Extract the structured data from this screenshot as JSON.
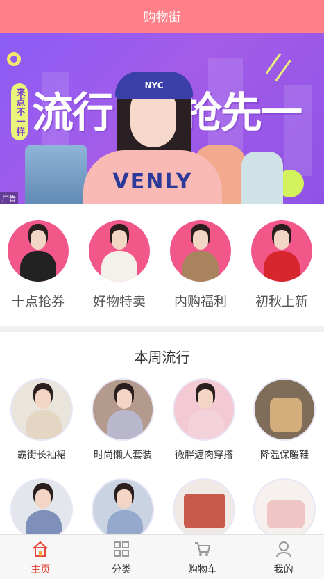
{
  "header": {
    "title": "购物街"
  },
  "banner": {
    "badge": "来点不一样",
    "slogan_left": "流行",
    "slogan_right": "抢先一步",
    "hat_text": "NYC",
    "shirt_text": "VENLY",
    "ad_label": "广告"
  },
  "categories": [
    {
      "label": "十点抢券",
      "shirt_color": "#222222"
    },
    {
      "label": "好物特卖",
      "shirt_color": "#f4f0ea"
    },
    {
      "label": "内购福利",
      "shirt_color": "#a8835e"
    },
    {
      "label": "初秋上新",
      "shirt_color": "#d8262e"
    }
  ],
  "weekly": {
    "title": "本周流行",
    "items": [
      {
        "label": "霸街长袖裙",
        "bg": "#e9e4dc",
        "shirt": "#e5d6c4"
      },
      {
        "label": "时尚懒人套装",
        "bg": "#b39a8c",
        "shirt": "#b9b7cc"
      },
      {
        "label": "微胖遮肉穿搭",
        "bg": "#f3c9d4",
        "shirt": "#f4d2dc"
      },
      {
        "label": "降温保暖鞋",
        "bg": "#7f6d5a",
        "shirt": "#d4ad7c"
      },
      {
        "label": "",
        "bg": "#e4e6ee",
        "shirt": "#7e8fb9"
      },
      {
        "label": "",
        "bg": "#c9d3e2",
        "shirt": "#95a9cc"
      },
      {
        "label": "",
        "bg": "#f1e9e6",
        "shirt": "#c75a4b"
      },
      {
        "label": "",
        "bg": "#f6f0ee",
        "shirt": "#efc6c3"
      }
    ]
  },
  "tabbar": {
    "active_color": "#e5483f",
    "items": [
      {
        "label": "主页",
        "icon": "home-icon"
      },
      {
        "label": "分类",
        "icon": "category-icon"
      },
      {
        "label": "购物车",
        "icon": "cart-icon"
      },
      {
        "label": "我的",
        "icon": "profile-icon"
      }
    ]
  }
}
